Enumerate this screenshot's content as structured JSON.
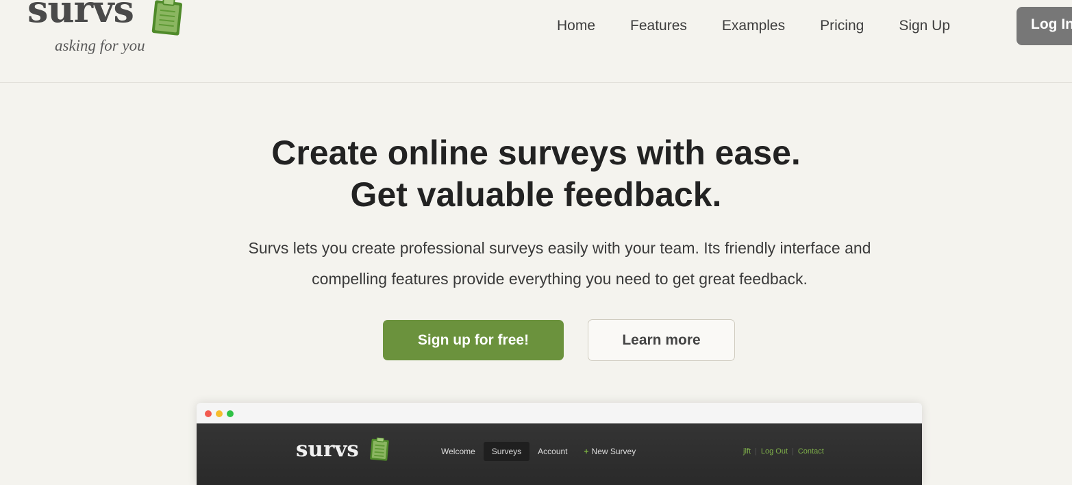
{
  "header": {
    "logo_text": "survs",
    "tagline": "asking for you",
    "nav": [
      {
        "label": "Home"
      },
      {
        "label": "Features"
      },
      {
        "label": "Examples"
      },
      {
        "label": "Pricing"
      },
      {
        "label": "Sign Up"
      }
    ],
    "login_label": "Log In"
  },
  "hero": {
    "title_line1": "Create online surveys with ease.",
    "title_line2": "Get valuable feedback.",
    "subtitle_line1": "Survs lets you create professional surveys easily with your team. Its friendly interface and",
    "subtitle_line2": "compelling features provide everything you need to get great feedback.",
    "primary_button": "Sign up for free!",
    "secondary_button": "Learn more"
  },
  "preview": {
    "logo_text": "survs",
    "nav": [
      {
        "label": "Welcome"
      },
      {
        "label": "Surveys"
      },
      {
        "label": "Account"
      },
      {
        "label": "New Survey",
        "icon": "plus-icon"
      }
    ],
    "user_links": [
      {
        "label": "jlft"
      },
      {
        "label": "Log Out"
      },
      {
        "label": "Contact"
      }
    ]
  },
  "colors": {
    "brand_green": "#6b923d",
    "background": "#f4f3ee",
    "login_bg": "#777777",
    "dot_red": "#f25a4f",
    "dot_yellow": "#f6bd2d",
    "dot_green": "#2fc246"
  }
}
